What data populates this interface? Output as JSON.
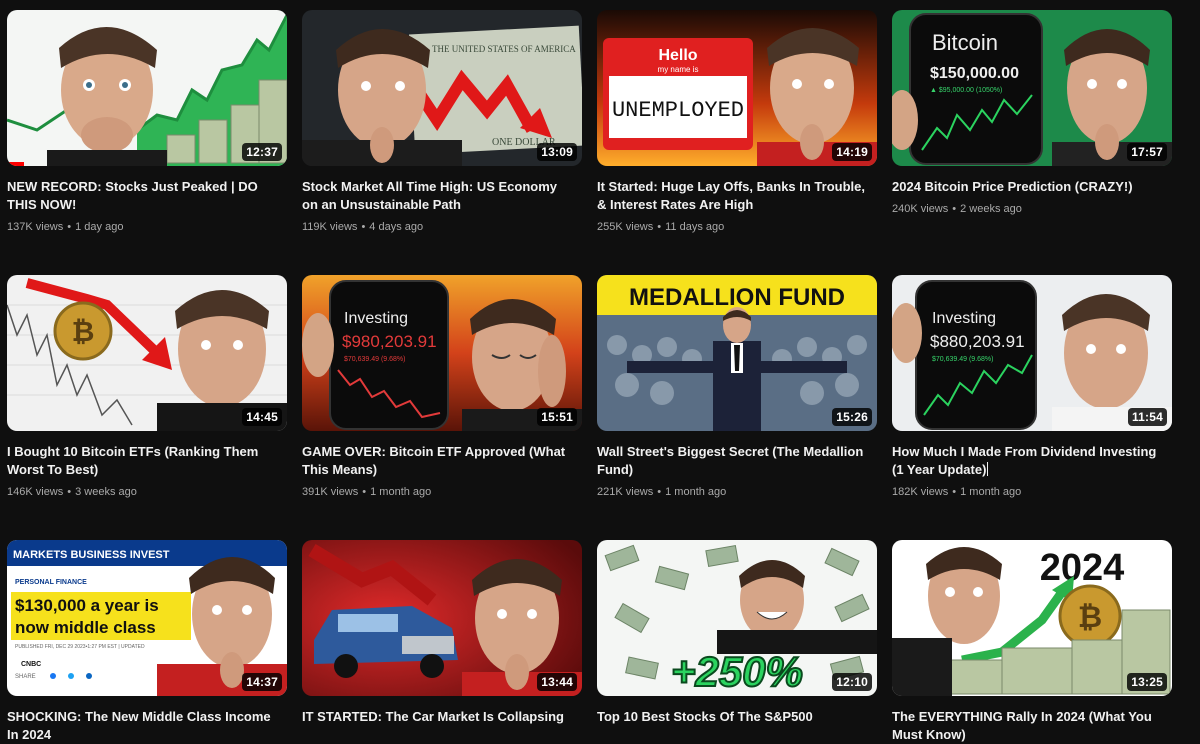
{
  "videos": [
    {
      "title": "NEW RECORD: Stocks Just Peaked | DO THIS NOW!",
      "duration": "12:37",
      "views": "137K views",
      "age": "1 day ago",
      "watched_fraction": 0.06
    },
    {
      "title": "Stock Market All Time High: US Economy on an Unsustainable Path",
      "duration": "13:09",
      "views": "119K views",
      "age": "4 days ago"
    },
    {
      "title": "It Started: Huge Lay Offs, Banks In Trouble, & Interest Rates Are High",
      "duration": "14:19",
      "views": "255K views",
      "age": "11 days ago"
    },
    {
      "title": "2024 Bitcoin Price Prediction (CRAZY!)",
      "duration": "17:57",
      "views": "240K views",
      "age": "2 weeks ago"
    },
    {
      "title": "I Bought 10 Bitcoin ETFs (Ranking Them Worst To Best)",
      "duration": "14:45",
      "views": "146K views",
      "age": "3 weeks ago"
    },
    {
      "title": "GAME OVER: Bitcoin ETF Approved (What This Means)",
      "duration": "15:51",
      "views": "391K views",
      "age": "1 month ago"
    },
    {
      "title": "Wall Street's Biggest Secret (The Medallion Fund)",
      "duration": "15:26",
      "views": "221K views",
      "age": "1 month ago"
    },
    {
      "title": "How Much I Made From Dividend Investing (1 Year Update)",
      "duration": "11:54",
      "views": "182K views",
      "age": "1 month ago"
    },
    {
      "title": "SHOCKING: The New Middle Class Income In 2024",
      "duration": "14:37",
      "views": "",
      "age": ""
    },
    {
      "title": "IT STARTED: The Car Market Is Collapsing",
      "duration": "13:44",
      "views": "",
      "age": ""
    },
    {
      "title": "Top 10 Best Stocks Of The S&P500",
      "duration": "12:10",
      "views": "",
      "age": ""
    },
    {
      "title": "The EVERYTHING Rally In 2024 (What You Must Know)",
      "duration": "13:25",
      "views": "",
      "age": ""
    }
  ],
  "thumb_text": {
    "t2_bill": "THE UNITED STATES OF AMERICA",
    "t2_bill2": "ONE DOLLAR",
    "t3_hello": "Hello",
    "t3_name": "my name is",
    "t3_word": "UNEMPLOYED",
    "t4_coin": "Bitcoin",
    "t4_value": "$150,000.00",
    "t4_change": "▲ $95,000.00 (1050%)",
    "t6_label": "Investing",
    "t6_value": "$980,203.91",
    "t6_change": "$70,639.49 (9.68%)",
    "t7_banner": "MEDALLION FUND",
    "t8_label": "Investing",
    "t8_value": "$880,203.91",
    "t8_change": "$70,639.49 (9.68%)",
    "t9_nav": "MARKETS  BUSINESS  INVEST",
    "t9_section": "PERSONAL FINANCE",
    "t9_headline1": "$130,000 a year is",
    "t9_headline2": "now middle class",
    "t9_pub": "PUBLISHED FRI, DEC 29 2023•1:27 PM EST | UPDATED",
    "t9_logo": "CNBC",
    "t9_share": "SHARE",
    "t11_pct": "+250%",
    "t12_year": "2024"
  },
  "colors": {
    "page_bg": "#0f0f0f",
    "title": "#f1f1f1",
    "meta": "#aaaaaa",
    "progress": "#ff0000"
  }
}
